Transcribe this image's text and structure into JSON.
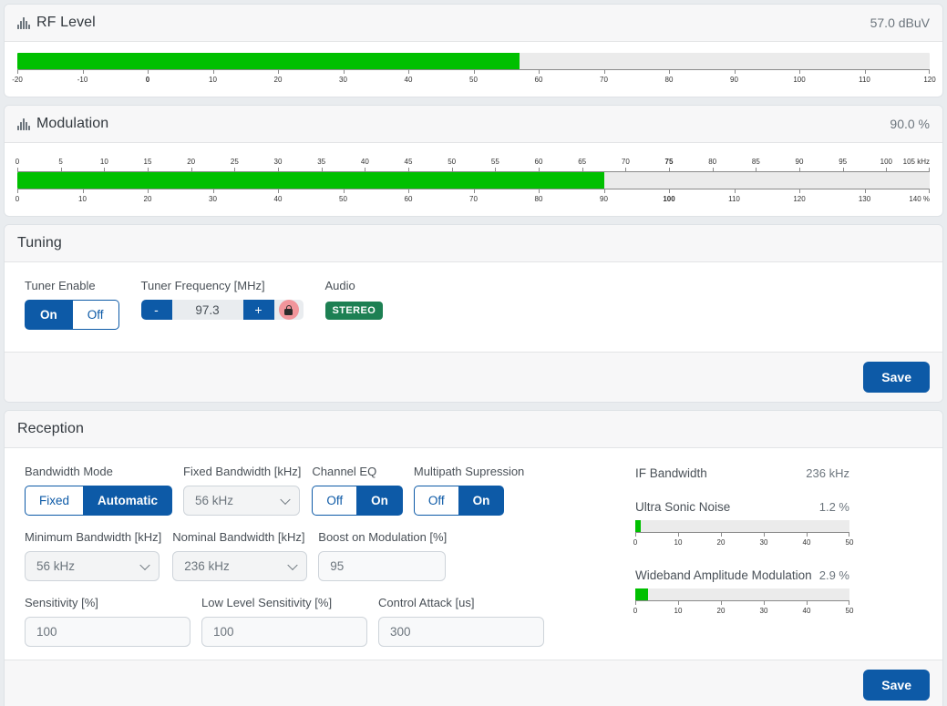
{
  "rf_level": {
    "title": "RF Level",
    "icon": "signal-icon",
    "value": "57.0 dBuV",
    "fill_percent": 55.0
  },
  "modulation": {
    "title": "Modulation",
    "icon": "signal-icon",
    "value": "90.0 %",
    "fill_percent": 67.14
  },
  "tuning": {
    "title": "Tuning",
    "tuner_enable": {
      "label": "Tuner Enable",
      "on": "On",
      "off": "Off",
      "selected": "On"
    },
    "tuner_frequency": {
      "label": "Tuner Frequency [MHz]",
      "minus": "-",
      "plus": "+",
      "value": "97.3",
      "lock_icon": "lock-icon"
    },
    "audio": {
      "label": "Audio",
      "badge": "STEREO"
    },
    "save_label": "Save"
  },
  "reception": {
    "title": "Reception",
    "bandwidth_mode": {
      "label": "Bandwidth Mode",
      "options": [
        "Fixed",
        "Automatic"
      ],
      "selected": "Automatic"
    },
    "fixed_bandwidth": {
      "label": "Fixed Bandwidth [kHz]",
      "value": "56 kHz"
    },
    "channel_eq": {
      "label": "Channel EQ",
      "options": [
        "Off",
        "On"
      ],
      "selected": "On"
    },
    "multipath": {
      "label": "Multipath Supression",
      "options": [
        "Off",
        "On"
      ],
      "selected": "On"
    },
    "minimum_bandwidth": {
      "label": "Minimum Bandwidth [kHz]",
      "value": "56 kHz"
    },
    "nominal_bandwidth": {
      "label": "Nominal Bandwidth [kHz]",
      "value": "236 kHz"
    },
    "boost_on_modulation": {
      "label": "Boost on Modulation [%]",
      "value": "95"
    },
    "sensitivity": {
      "label": "Sensitivity [%]",
      "value": "100"
    },
    "low_level_sensitivity": {
      "label": "Low Level Sensitivity [%]",
      "value": "100"
    },
    "control_attack": {
      "label": "Control Attack [us]",
      "value": "300"
    },
    "if_bandwidth": {
      "label": "IF Bandwidth",
      "value": "236 kHz"
    },
    "ultra_sonic_noise": {
      "label": "Ultra Sonic Noise",
      "value": "1.2 %",
      "fill_percent": 2.4
    },
    "wideband_am": {
      "label": "Wideband Amplitude Modulation",
      "value": "2.9 %",
      "fill_percent": 5.8
    },
    "save_label": "Save"
  },
  "chart_data": [
    {
      "type": "bar",
      "title": "RF Level",
      "value": 57.0,
      "unit": "dBuV",
      "xlim": [
        -20,
        120
      ],
      "ticks": [
        -20,
        -10,
        0,
        10,
        20,
        30,
        40,
        50,
        60,
        70,
        80,
        90,
        100,
        110,
        120
      ],
      "tick_labels": [
        "-20",
        "-10",
        "0",
        "10",
        "20",
        "30",
        "40",
        "50",
        "60",
        "70",
        "80",
        "90",
        "100",
        "110",
        "120"
      ],
      "bold_ticks": [
        0
      ],
      "axis_position": "bottom",
      "grid": false,
      "fill_color": "#00c000",
      "track_color": "#ebebeb"
    },
    {
      "type": "bar",
      "title": "Modulation",
      "value": 90.0,
      "unit": "%",
      "xlim": [
        0,
        140
      ],
      "ticks": [
        0,
        10,
        20,
        30,
        40,
        50,
        60,
        70,
        80,
        90,
        100,
        110,
        120,
        130,
        140
      ],
      "tick_labels": [
        "0",
        "10",
        "20",
        "30",
        "40",
        "50",
        "60",
        "70",
        "80",
        "90",
        "100",
        "110",
        "120",
        "130",
        "140 %"
      ],
      "bold_ticks": [
        100
      ],
      "axis_position": "bottom",
      "secondary_axis": {
        "position": "top",
        "xlim": [
          0,
          105
        ],
        "ticks": [
          0,
          5,
          10,
          15,
          20,
          25,
          30,
          35,
          40,
          45,
          50,
          55,
          60,
          65,
          70,
          75,
          80,
          85,
          90,
          95,
          100,
          105
        ],
        "tick_labels": [
          "0",
          "5",
          "10",
          "15",
          "20",
          "25",
          "30",
          "35",
          "40",
          "45",
          "50",
          "55",
          "60",
          "65",
          "70",
          "75",
          "80",
          "85",
          "90",
          "95",
          "100",
          "105 kHz"
        ],
        "bold_ticks": [
          75
        ],
        "unit": "kHz"
      },
      "grid": false,
      "fill_color": "#00c000",
      "track_color": "#ebebeb"
    },
    {
      "type": "bar",
      "title": "Ultra Sonic Noise",
      "value": 1.2,
      "unit": "%",
      "xlim": [
        0,
        50
      ],
      "ticks": [
        0,
        10,
        20,
        30,
        40,
        50
      ],
      "tick_labels": [
        "0",
        "10",
        "20",
        "30",
        "40",
        "50"
      ],
      "axis_position": "bottom",
      "grid": false,
      "fill_color": "#00c000",
      "track_color": "#ebebeb"
    },
    {
      "type": "bar",
      "title": "Wideband Amplitude Modulation",
      "value": 2.9,
      "unit": "%",
      "xlim": [
        0,
        50
      ],
      "ticks": [
        0,
        10,
        20,
        30,
        40,
        50
      ],
      "tick_labels": [
        "0",
        "10",
        "20",
        "30",
        "40",
        "50"
      ],
      "axis_position": "bottom",
      "grid": false,
      "fill_color": "#00c000",
      "track_color": "#ebebeb"
    }
  ]
}
